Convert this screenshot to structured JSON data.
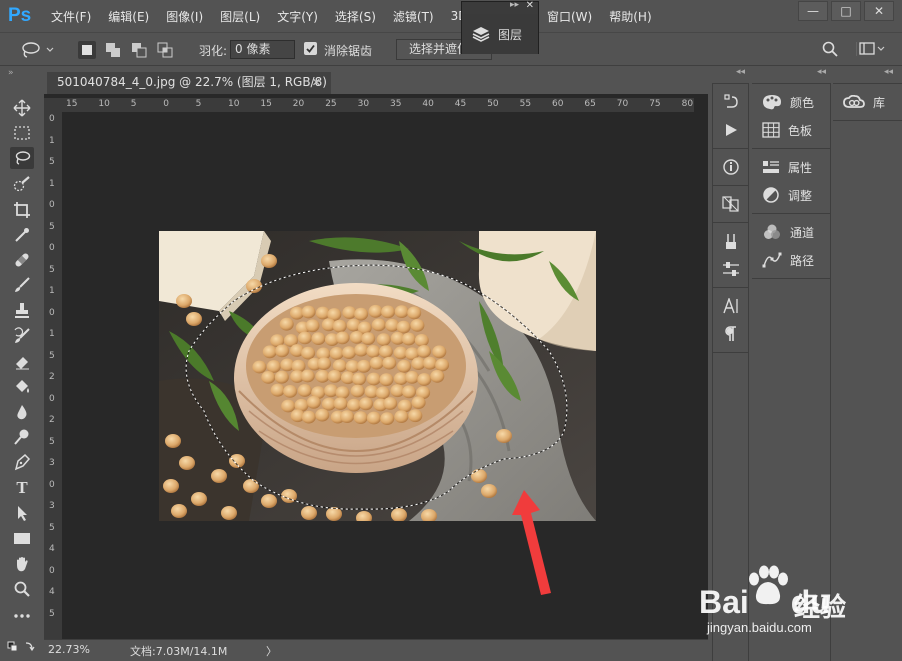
{
  "app": {
    "logo": "Ps"
  },
  "menu": {
    "items": [
      "文件(F)",
      "编辑(E)",
      "图像(I)",
      "图层(L)",
      "文字(Y)",
      "选择(S)",
      "滤镜(T)",
      "3D("
    ],
    "items_right": [
      "窗口(W)",
      "帮助(H)"
    ]
  },
  "window_buttons": {
    "minimize": "—",
    "maximize": "□",
    "close": "✕"
  },
  "layer_popup": {
    "label": "图层",
    "collapse": "▸▸",
    "close": "✕"
  },
  "options": {
    "feather_label": "羽化:",
    "feather_value": "0 像素",
    "antialias_label": "消除锯齿",
    "select_mask_label": "选择并遮住..."
  },
  "document": {
    "tab_title": "501040784_4_0.jpg @ 22.7% (图层 1, RGB/8) *",
    "tab_close": "✕",
    "ruler_h": [
      "15",
      "10",
      "5",
      "0",
      "5",
      "10",
      "15",
      "20",
      "25",
      "30",
      "35",
      "40",
      "45",
      "50",
      "55",
      "60",
      "65",
      "70",
      "75",
      "80"
    ],
    "ruler_v": [
      "0",
      "1",
      "5",
      "1",
      "0",
      "5",
      "0",
      "5",
      "1",
      "0",
      "1",
      "5",
      "2",
      "0",
      "2",
      "5",
      "3",
      "0",
      "3",
      "5",
      "4",
      "0",
      "4",
      "5"
    ]
  },
  "status": {
    "zoom": "22.73%",
    "doc_info": "文档:7.03M/14.1M",
    "arrow": "〉"
  },
  "right_panels": {
    "col2_groups": [
      [
        {
          "icon": "palette-icon",
          "label": "颜色"
        },
        {
          "icon": "grid-icon",
          "label": "色板"
        }
      ],
      [
        {
          "icon": "properties-icon",
          "label": "属性"
        },
        {
          "icon": "adjust-icon",
          "label": "调整"
        }
      ],
      [
        {
          "icon": "channels-icon",
          "label": "通道"
        },
        {
          "icon": "paths-icon",
          "label": "路径"
        }
      ]
    ],
    "col3_label": "库"
  },
  "watermark": {
    "brand": "Bai",
    "brand_du": "du",
    "cn": "经验",
    "url": "jingyan.baidu.com"
  },
  "colors": {
    "ps_blue": "#31a8ff",
    "canvas_bg": "#282828",
    "ui_bg": "#535353",
    "arrow_red": "#f03c3c"
  }
}
